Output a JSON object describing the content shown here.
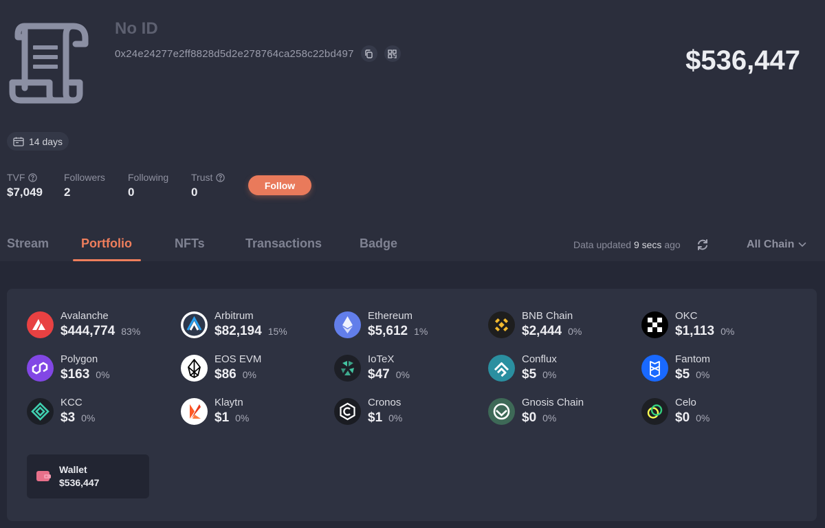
{
  "profile": {
    "name": "No ID",
    "address": "0x24e24277e2ff8828d5d2e278764ca258c22bd497",
    "total_value": "$536,447",
    "age": "14 days"
  },
  "stats": [
    {
      "label": "TVF",
      "value": "$7,049",
      "has_help": true
    },
    {
      "label": "Followers",
      "value": "2",
      "has_help": false
    },
    {
      "label": "Following",
      "value": "0",
      "has_help": false
    },
    {
      "label": "Trust",
      "value": "0",
      "has_help": true
    }
  ],
  "follow_label": "Follow",
  "tabs": [
    {
      "label": "Stream",
      "active": false
    },
    {
      "label": "Portfolio",
      "active": true
    },
    {
      "label": "NFTs",
      "active": false
    },
    {
      "label": "Transactions",
      "active": false
    },
    {
      "label": "Badge",
      "active": false
    }
  ],
  "updated": {
    "prefix": "Data updated",
    "time": "9 secs",
    "suffix": "ago"
  },
  "chain_filter": "All Chain",
  "chains": [
    {
      "name": "Avalanche",
      "value": "$444,774",
      "pct": "83%",
      "icon": "avalanche-icon",
      "color": "#e84142"
    },
    {
      "name": "Arbitrum",
      "value": "$82,194",
      "pct": "15%",
      "icon": "arbitrum-icon",
      "color": "#ffffff"
    },
    {
      "name": "Ethereum",
      "value": "$5,612",
      "pct": "1%",
      "icon": "ethereum-icon",
      "color": "#627eea"
    },
    {
      "name": "BNB Chain",
      "value": "$2,444",
      "pct": "0%",
      "icon": "bnb-icon",
      "color": "#1e1e1e"
    },
    {
      "name": "OKC",
      "value": "$1,113",
      "pct": "0%",
      "icon": "okc-icon",
      "color": "#ffffff"
    },
    {
      "name": "Polygon",
      "value": "$163",
      "pct": "0%",
      "icon": "polygon-icon",
      "color": "#8247e5"
    },
    {
      "name": "EOS EVM",
      "value": "$86",
      "pct": "0%",
      "icon": "eos-evm-icon",
      "color": "#ffffff"
    },
    {
      "name": "IoTeX",
      "value": "$47",
      "pct": "0%",
      "icon": "iotex-icon",
      "color": "#1d1f26"
    },
    {
      "name": "Conflux",
      "value": "$5",
      "pct": "0%",
      "icon": "conflux-icon",
      "color": "#2a8fa0"
    },
    {
      "name": "Fantom",
      "value": "$5",
      "pct": "0%",
      "icon": "fantom-icon",
      "color": "#1969ff"
    },
    {
      "name": "KCC",
      "value": "$3",
      "pct": "0%",
      "icon": "kcc-icon",
      "color": "#1c1f26"
    },
    {
      "name": "Klaytn",
      "value": "$1",
      "pct": "0%",
      "icon": "klaytn-icon",
      "color": "#ffffff"
    },
    {
      "name": "Cronos",
      "value": "$1",
      "pct": "0%",
      "icon": "cronos-icon",
      "color": "#1a1c22"
    },
    {
      "name": "Gnosis Chain",
      "value": "$0",
      "pct": "0%",
      "icon": "gnosis-icon",
      "color": "#3e6957"
    },
    {
      "name": "Celo",
      "value": "$0",
      "pct": "0%",
      "icon": "celo-icon",
      "color": "#1d1f24"
    }
  ],
  "wallet": {
    "label": "Wallet",
    "value": "$536,447"
  },
  "colors": {
    "accent": "#ef7e5c",
    "background": "#2b2e3c",
    "panel": "#2e3241"
  }
}
